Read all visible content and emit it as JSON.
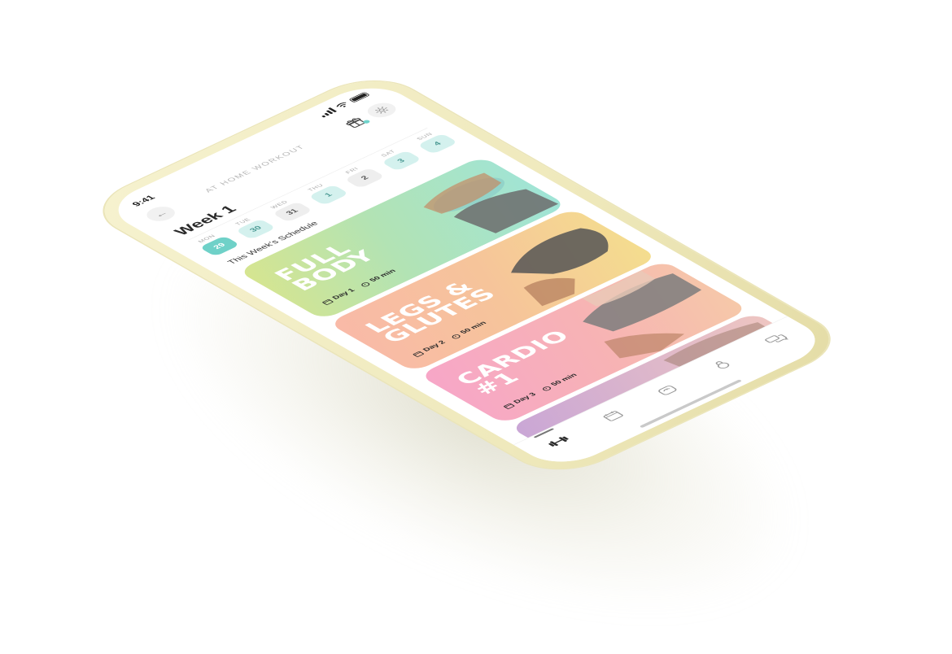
{
  "status_bar": {
    "time": "9:41",
    "icons": [
      "signal-icon",
      "wifi-icon",
      "battery-icon"
    ]
  },
  "header": {
    "title": "AT HOME WORKOUT",
    "back_icon": "arrow-left-icon",
    "gift_icon": "gift-icon",
    "settings_icon": "gear-icon"
  },
  "week": {
    "title": "Week 1",
    "days": [
      {
        "name": "MON",
        "num": "29",
        "state": "active"
      },
      {
        "name": "TUE",
        "num": "30",
        "state": "mint"
      },
      {
        "name": "WED",
        "num": "31",
        "state": "gray"
      },
      {
        "name": "THU",
        "num": "1",
        "state": "mint"
      },
      {
        "name": "FRI",
        "num": "2",
        "state": "gray"
      },
      {
        "name": "SAT",
        "num": "3",
        "state": "mint"
      },
      {
        "name": "SUN",
        "num": "4",
        "state": "mint"
      }
    ]
  },
  "schedule_label": "This Week's Schedule",
  "workouts": [
    {
      "title_line1": "FULL",
      "title_line2": "BODY",
      "day": "Day 1",
      "duration": "50 min"
    },
    {
      "title_line1": "LEGS &",
      "title_line2": "GLUTES",
      "day": "Day 2",
      "duration": "50 min"
    },
    {
      "title_line1": "CARDIO",
      "title_line2": "#1",
      "day": "Day 3",
      "duration": "50 min"
    }
  ],
  "tabbar": {
    "tabs": [
      "dumbbell-icon",
      "calendar-icon",
      "scale-icon",
      "kettlebell-icon",
      "chat-icon"
    ],
    "active_tab": "dumbbell-icon"
  },
  "colors": {
    "phone_frame": "#efe9bc",
    "accent_mint": "#6fd1c8",
    "card1_gradient": [
      "#d7e58f",
      "#9fe4d8"
    ],
    "card2_gradient": [
      "#f9b9a8",
      "#f4de8e"
    ],
    "card3_gradient": [
      "#f7a6c8",
      "#f6c9a8"
    ]
  }
}
